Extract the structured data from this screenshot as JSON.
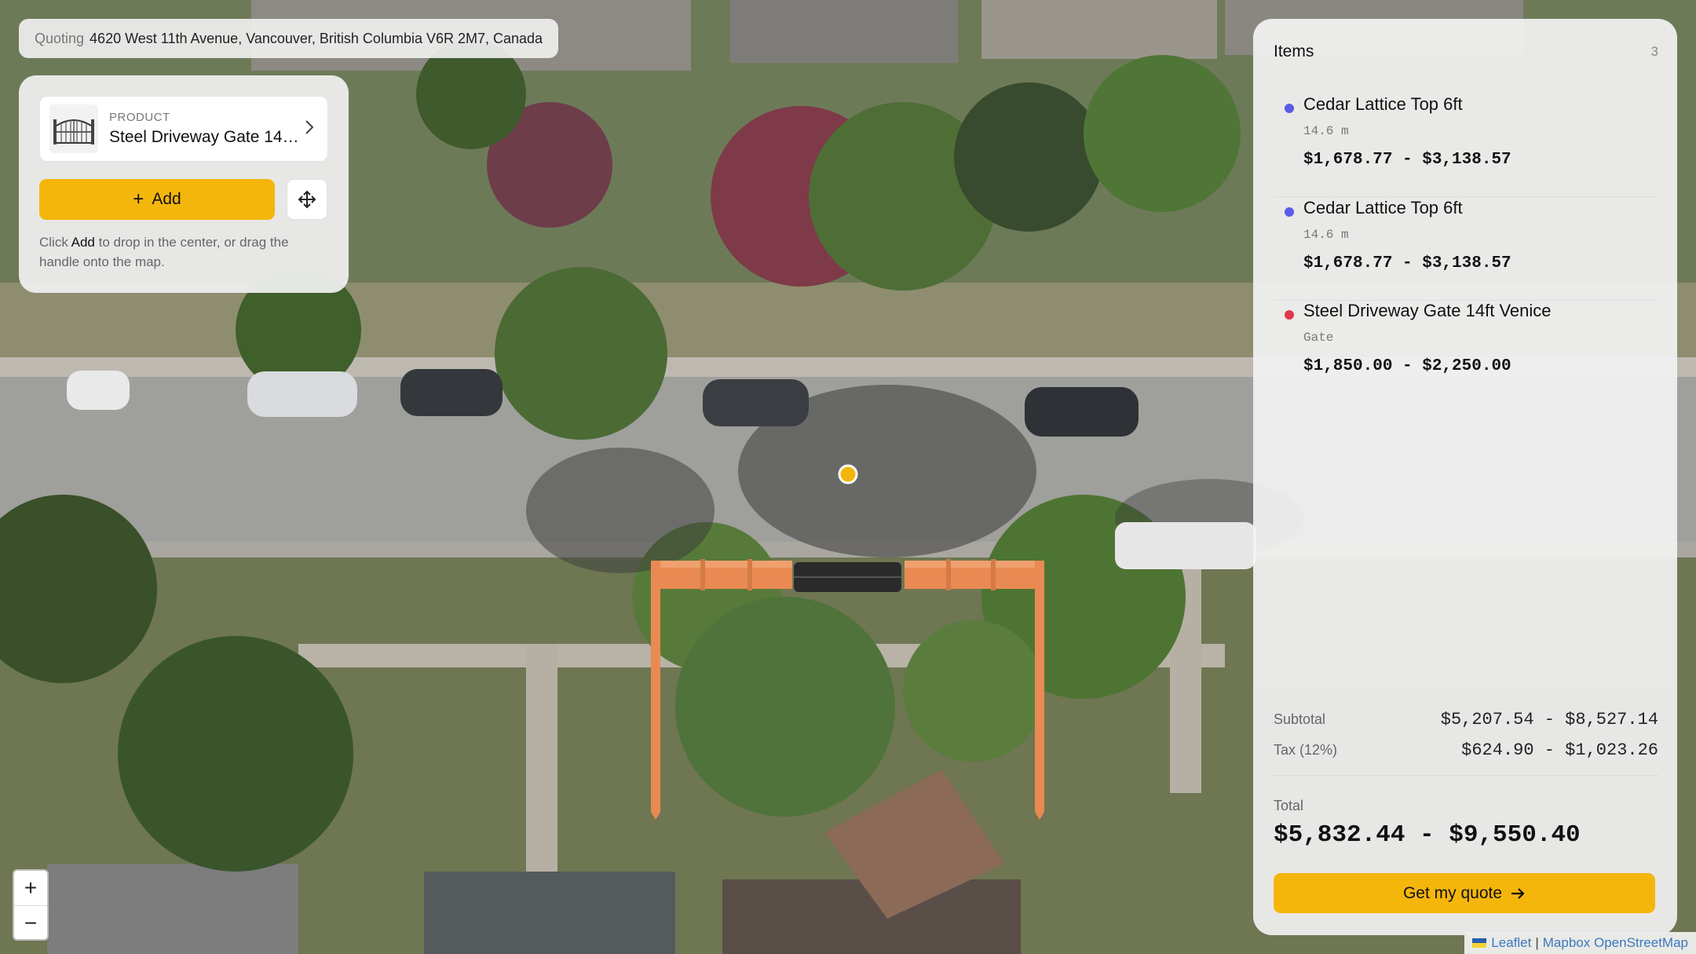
{
  "map": {
    "marker_color": "#f5b60c",
    "fence_color": "#e98a52",
    "gate_color": "#2b2b2b",
    "zoom_in_label": "+",
    "zoom_out_label": "−"
  },
  "address": {
    "prefix": "Quoting",
    "text": "4620 West 11th Avenue, Vancouver, British Columbia V6R 2M7, Canada"
  },
  "product": {
    "kicker": "PRODUCT",
    "name": "Steel Driveway Gate 14ft Venice",
    "add_label": "Add",
    "hint_pre": "Click ",
    "hint_bold": "Add",
    "hint_post": " to drop in the center, or drag the handle onto the map."
  },
  "items_panel": {
    "title": "Items",
    "count": "3",
    "items": [
      {
        "name": "Cedar Lattice Top 6ft",
        "sub": "14.6 m",
        "price": "$1,678.77 - $3,138.57",
        "dot_color": "#5b5ce6"
      },
      {
        "name": "Cedar Lattice Top 6ft",
        "sub": "14.6 m",
        "price": "$1,678.77 - $3,138.57",
        "dot_color": "#5b5ce6"
      },
      {
        "name": "Steel Driveway Gate 14ft Venice",
        "sub": "Gate",
        "price": "$1,850.00 - $2,250.00",
        "dot_color": "#e2384d"
      }
    ],
    "subtotal_label": "Subtotal",
    "subtotal_value": "$5,207.54 - $8,527.14",
    "tax_label": "Tax (12%)",
    "tax_value": "$624.90 - $1,023.26",
    "total_label": "Total",
    "total_value": "$5,832.44 - $9,550.40",
    "cta_label": "Get my quote"
  },
  "attribution": {
    "leaflet": "Leaflet",
    "sep": "|",
    "mapbox": "Mapbox",
    "osm": "OpenStreetMap"
  }
}
